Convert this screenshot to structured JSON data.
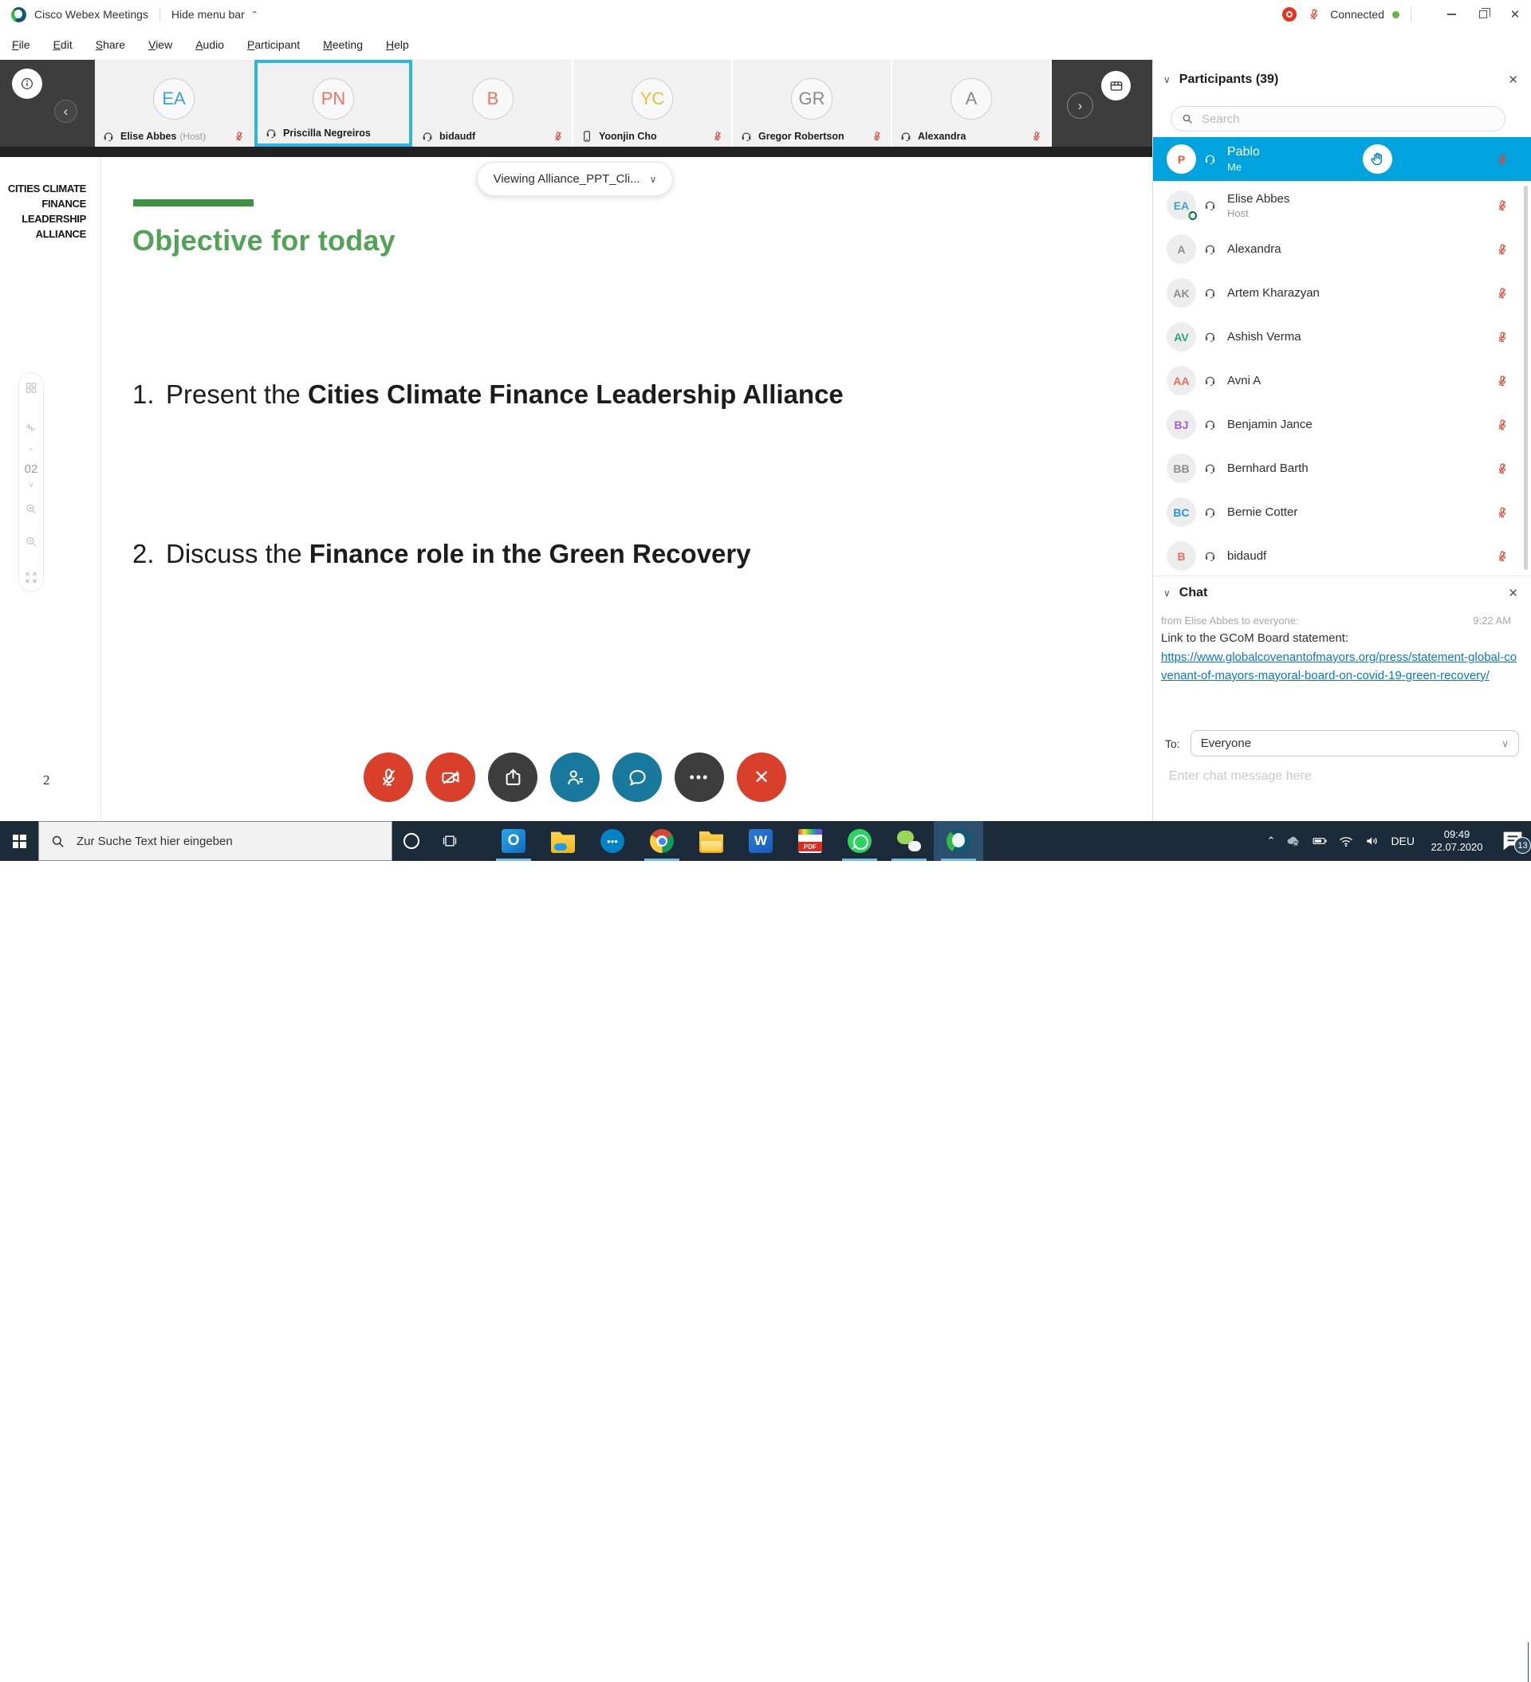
{
  "colors": {
    "selected_row_blue": "#00a3dd",
    "button_red": "#d8402b",
    "button_dark": "#3d3d3d",
    "button_teal": "#19799c",
    "slide_green": "#52a356",
    "muted_mic_red": "#e0442e",
    "selected_tile_border": "#29b7ea",
    "link_blue": "#0b76c8",
    "taskbar_bg": "#1c2b3a"
  },
  "titlebar": {
    "app_name": "Cisco Webex Meetings",
    "hide_menu_label": "Hide menu bar",
    "connection_status": "Connected"
  },
  "menu_bar": {
    "items": [
      "File",
      "Edit",
      "Share",
      "View",
      "Audio",
      "Participant",
      "Meeting",
      "Help"
    ]
  },
  "video_strip": {
    "tiles": [
      {
        "initials": "EA",
        "initials_color": "#3aa0dc",
        "name": "Elise Abbes",
        "suffix": "(Host)",
        "device": "headset",
        "muted": true,
        "selected": false
      },
      {
        "initials": "PN",
        "initials_color": "#ef7262",
        "name": "Priscilla Negreiros",
        "suffix": "",
        "device": "headset",
        "muted": false,
        "selected": true
      },
      {
        "initials": "B",
        "initials_color": "#ef7262",
        "name": "bidaudf",
        "suffix": "",
        "device": "headset",
        "muted": true,
        "selected": false
      },
      {
        "initials": "YC",
        "initials_color": "#eebd3a",
        "name": "Yoonjin Cho",
        "suffix": "",
        "device": "phone",
        "muted": true,
        "selected": false
      },
      {
        "initials": "GR",
        "initials_color": "#8a8a8a",
        "name": "Gregor Robertson",
        "suffix": "",
        "device": "headset",
        "muted": true,
        "selected": false
      },
      {
        "initials": "A",
        "initials_color": "#8a8a8a",
        "name": "Alexandra",
        "suffix": "",
        "device": "headset",
        "muted": true,
        "selected": false
      }
    ]
  },
  "presentation": {
    "viewing_label": "Viewing Alliance_PPT_Cli...",
    "logo_lines": [
      "CITIES CLIMATE",
      "FINANCE",
      "LEADERSHIP",
      "ALLIANCE"
    ],
    "tools_page_indicator": "02",
    "slide": {
      "title": "Objective for today",
      "items": [
        {
          "number": "1.",
          "prefix": "Present the ",
          "bold": "Cities Climate Finance Leadership Alliance"
        },
        {
          "number": "2.",
          "prefix": "Discuss the ",
          "bold": "Finance role in the Green Recovery"
        }
      ],
      "page_number": "2"
    }
  },
  "participants_panel": {
    "title": "Participants (39)",
    "search_placeholder": "Search",
    "me": {
      "initials": "P",
      "initials_color": "#e4573d",
      "name": "Pablo",
      "sub": "Me",
      "muted": true,
      "hand_raised": true
    },
    "list": [
      {
        "initials": "EA",
        "initials_color": "#3aa0dc",
        "name": "Elise Abbes",
        "sub": "Host",
        "badge": true,
        "muted": true
      },
      {
        "initials": "A",
        "initials_color": "#8c8c8c",
        "name": "Alexandra",
        "sub": "",
        "badge": false,
        "muted": true
      },
      {
        "initials": "AK",
        "initials_color": "#8c8c8c",
        "name": "Artem Kharazyan",
        "sub": "",
        "badge": false,
        "muted": true
      },
      {
        "initials": "AV",
        "initials_color": "#2aa77e",
        "name": "Ashish Verma",
        "sub": "",
        "badge": false,
        "muted": true
      },
      {
        "initials": "AA",
        "initials_color": "#ef6a5a",
        "name": "Avni A",
        "sub": "",
        "badge": false,
        "muted": true
      },
      {
        "initials": "BJ",
        "initials_color": "#a05fc9",
        "name": "Benjamin Jance",
        "sub": "",
        "badge": false,
        "muted": true
      },
      {
        "initials": "BB",
        "initials_color": "#8c8c8c",
        "name": "Bernhard Barth",
        "sub": "",
        "badge": false,
        "muted": true
      },
      {
        "initials": "BC",
        "initials_color": "#2196d9",
        "name": "Bernie Cotter",
        "sub": "",
        "badge": false,
        "muted": true
      },
      {
        "initials": "B",
        "initials_color": "#ef6a5a",
        "name": "bidaudf",
        "sub": "",
        "badge": false,
        "muted": true
      }
    ]
  },
  "chat_panel": {
    "title": "Chat",
    "meta": "from Elise Abbes to everyone:",
    "timestamp": "9:22 AM",
    "message": "Link to the GCoM Board statement:",
    "link": "https://www.globalcovenantofmayors.org/press/statement-global-covenant-of-mayors-mayoral-board-on-covid-19-green-recovery/",
    "to_label": "To:",
    "to_value": "Everyone",
    "input_placeholder": "Enter chat message here"
  },
  "controls": {
    "buttons": [
      {
        "icon": "mic-muted-icon",
        "style": "red"
      },
      {
        "icon": "camera-off-icon",
        "style": "red"
      },
      {
        "icon": "share-content-icon",
        "style": "dark"
      },
      {
        "icon": "participants-icon",
        "style": "teal"
      },
      {
        "icon": "chat-icon",
        "style": "teal"
      },
      {
        "icon": "more-options-icon",
        "style": "dark"
      },
      {
        "icon": "end-meeting-icon",
        "style": "red"
      }
    ]
  },
  "taskbar": {
    "search_placeholder": "Zur Suche Text hier eingeben",
    "apps": [
      {
        "icon": "outlook-icon",
        "running": true,
        "active": false
      },
      {
        "icon": "onedrive-folder-icon",
        "running": false,
        "active": false
      },
      {
        "icon": "nextcloud-icon",
        "running": false,
        "active": false
      },
      {
        "icon": "chrome-icon",
        "running": true,
        "active": false
      },
      {
        "icon": "explorer-icon",
        "running": false,
        "active": false
      },
      {
        "icon": "word-icon",
        "running": false,
        "active": false
      },
      {
        "icon": "pdf-icon",
        "running": false,
        "active": false
      },
      {
        "icon": "whatsapp-icon",
        "running": true,
        "active": false
      },
      {
        "icon": "wechat-icon",
        "running": true,
        "active": false
      },
      {
        "icon": "webex-icon",
        "running": true,
        "active": true
      }
    ],
    "tray": {
      "language": "DEU",
      "time": "09:49",
      "date": "22.07.2020",
      "notification_count": "13"
    }
  }
}
